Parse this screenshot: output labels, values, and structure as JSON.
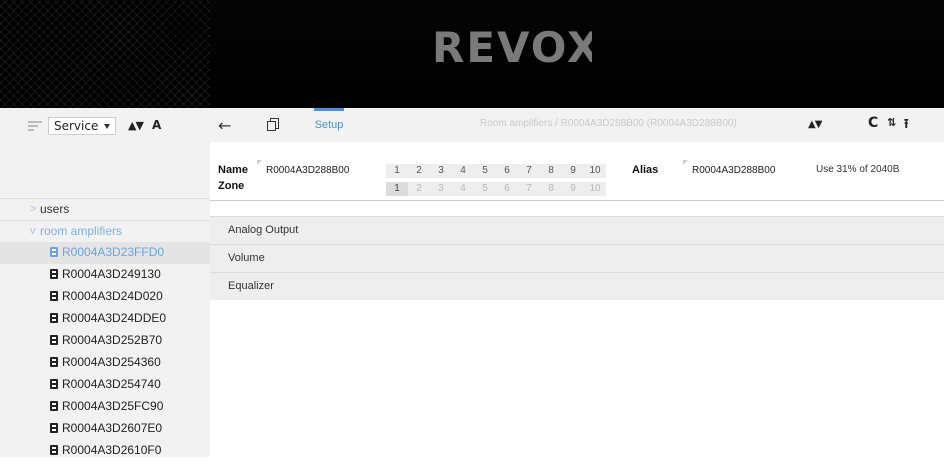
{
  "header": {
    "logo_text": "REVOX"
  },
  "sidebar": {
    "service_select": "Service",
    "sort_label": "▲▼",
    "font_label": "A",
    "groups": [
      {
        "label": "users",
        "expanded": false
      },
      {
        "label": "room amplifiers",
        "expanded": true
      }
    ],
    "items": [
      "R0004A3D23FFD0",
      "R0004A3D249130",
      "R0004A3D24D020",
      "R0004A3D24DDE0",
      "R0004A3D252B70",
      "R0004A3D254360",
      "R0004A3D254740",
      "R0004A3D25FC90",
      "R0004A3D2607E0",
      "R0004A3D2610F0"
    ],
    "selected_index": 0
  },
  "toolbar": {
    "back_icon": "arrow-left-icon",
    "copy_icon": "copy-icon",
    "setup_tab": "Setup",
    "breadcrumb": "Room amplifiers / R0004A3D288B00 (R0004A3D288B00)",
    "sort_label": "▲▼",
    "refresh_glyph": "C",
    "swap_glyph": "⇅",
    "upload_glyph": "⭱"
  },
  "form": {
    "name_label": "Name",
    "name_value": "R0004A3D288B00",
    "zone_label": "Zone",
    "alias_label": "Alias",
    "alias_value": "R0004A3D288B00",
    "usage": "Use 31% of 2040B",
    "name_pages": [
      "1",
      "2",
      "3",
      "4",
      "5",
      "6",
      "7",
      "8",
      "9",
      "10"
    ],
    "zone_pages": [
      "1",
      "2",
      "3",
      "4",
      "5",
      "6",
      "7",
      "8",
      "9",
      "10"
    ],
    "zone_active": 0
  },
  "sections": [
    "Analog Output",
    "Volume",
    "Equalizer"
  ],
  "colors": {
    "accent": "#4d90d9",
    "tree_link": "#7fb0e6"
  }
}
